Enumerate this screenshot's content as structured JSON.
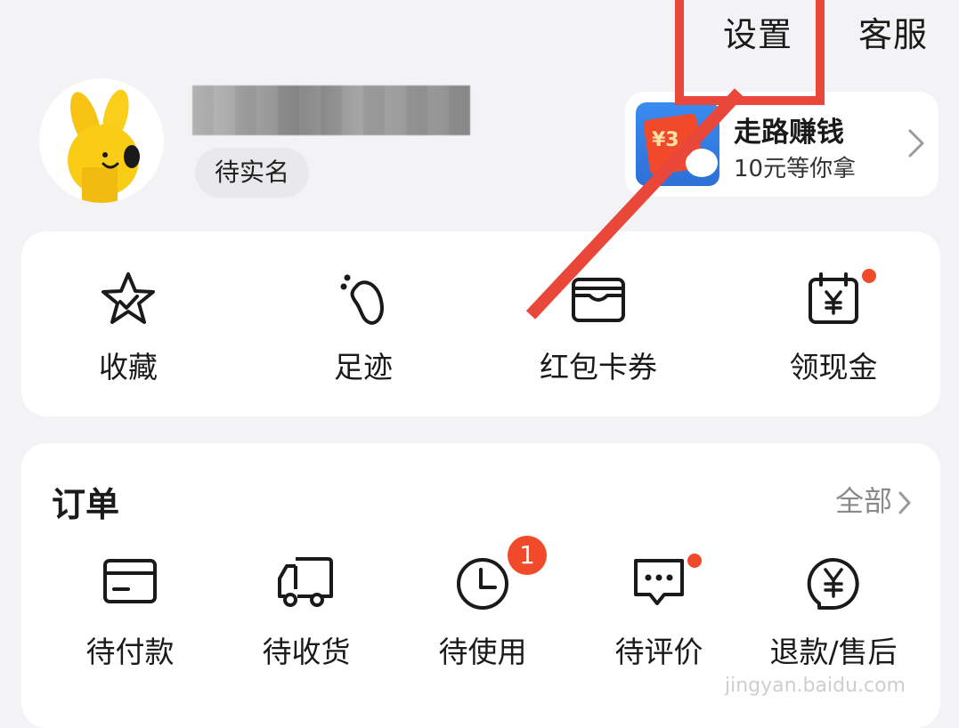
{
  "top_bar": {
    "settings_label": "设置",
    "service_label": "客服"
  },
  "profile": {
    "realname_status": "待实名"
  },
  "promo": {
    "title": "走路赚钱",
    "subtitle": "10元等你拿",
    "image_text": "¥3"
  },
  "quick_links": [
    {
      "label": "收藏",
      "icon": "star-icon"
    },
    {
      "label": "足迹",
      "icon": "footprint-icon"
    },
    {
      "label": "红包卡券",
      "icon": "wallet-icon"
    },
    {
      "label": "领现金",
      "icon": "calendar-yen-icon"
    }
  ],
  "orders": {
    "title": "订单",
    "all_label": "全部",
    "items": [
      {
        "label": "待付款",
        "icon": "card-icon"
      },
      {
        "label": "待收货",
        "icon": "truck-icon"
      },
      {
        "label": "待使用",
        "icon": "clock-icon",
        "badge": "1"
      },
      {
        "label": "待评价",
        "icon": "comment-icon"
      },
      {
        "label": "退款/售后",
        "icon": "refund-icon"
      }
    ]
  },
  "watermark": "jingyan.baidu.com",
  "colors": {
    "accent_red": "#f04a2a",
    "annotation_red": "#e8473a",
    "background": "#f3f3f5"
  }
}
